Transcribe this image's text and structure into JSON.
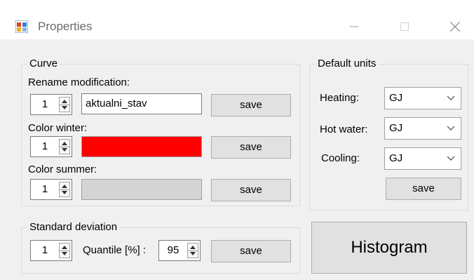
{
  "window": {
    "title": "Properties"
  },
  "curve": {
    "group_label": "Curve",
    "rename_label": "Rename modification:",
    "rename_index": "1",
    "rename_value": "aktualni_stav",
    "color_winter_label": "Color winter:",
    "winter_index": "1",
    "winter_color": "#ff0000",
    "color_summer_label": "Color summer:",
    "summer_index": "1",
    "summer_color": "#d4d4d4",
    "save_label": "save"
  },
  "default_units": {
    "group_label": "Default units",
    "heating_label": "Heating:",
    "heating_value": "GJ",
    "hot_water_label": "Hot water:",
    "hot_water_value": "GJ",
    "cooling_label": "Cooling:",
    "cooling_value": "GJ",
    "save_label": "save"
  },
  "standard_deviation": {
    "group_label": "Standard deviation",
    "index": "1",
    "quantile_label": "Quantile [%] :",
    "quantile_value": "95",
    "save_label": "save"
  },
  "histogram_label": "Histogram"
}
